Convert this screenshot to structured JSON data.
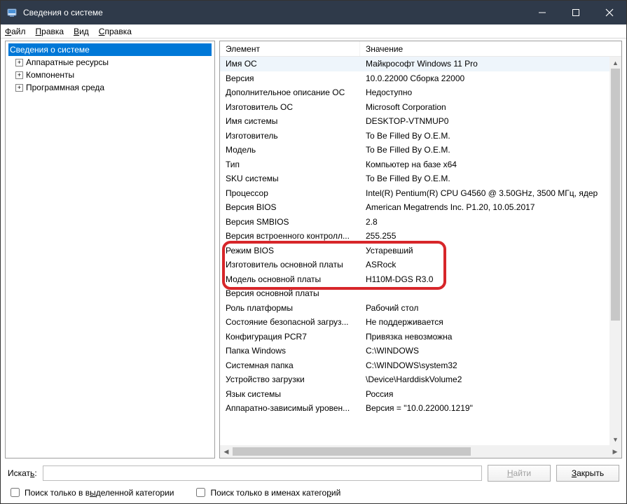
{
  "title": "Сведения о системе",
  "menu": {
    "file": {
      "u": "Ф",
      "rest": "айл"
    },
    "edit": {
      "u": "П",
      "rest": "равка"
    },
    "view": {
      "u": "В",
      "rest": "ид"
    },
    "help": {
      "u": "С",
      "rest": "правка"
    }
  },
  "tree": {
    "root": "Сведения о системе",
    "items": [
      "Аппаратные ресурсы",
      "Компоненты",
      "Программная среда"
    ]
  },
  "columns": {
    "c1": "Элемент",
    "c2": "Значение"
  },
  "data_rows": [
    {
      "el": "Имя ОС",
      "val": "Майкрософт Windows 11 Pro",
      "sel": true
    },
    {
      "el": "Версия",
      "val": "10.0.22000 Сборка 22000"
    },
    {
      "el": "Дополнительное описание ОС",
      "val": "Недоступно"
    },
    {
      "el": "Изготовитель ОС",
      "val": "Microsoft Corporation"
    },
    {
      "el": "Имя системы",
      "val": "DESKTOP-VTNMUP0"
    },
    {
      "el": "Изготовитель",
      "val": "To Be Filled By O.E.M."
    },
    {
      "el": "Модель",
      "val": "To Be Filled By O.E.M."
    },
    {
      "el": "Тип",
      "val": "Компьютер на базе x64"
    },
    {
      "el": "SKU системы",
      "val": "To Be Filled By O.E.M."
    },
    {
      "el": "Процессор",
      "val": "Intel(R) Pentium(R) CPU G4560 @ 3.50GHz, 3500 МГц, ядер"
    },
    {
      "el": "Версия BIOS",
      "val": "American Megatrends Inc. P1.20, 10.05.2017"
    },
    {
      "el": "Версия SMBIOS",
      "val": "2.8"
    },
    {
      "el": "Версия встроенного контролл...",
      "val": "255.255"
    },
    {
      "el": "Режим BIOS",
      "val": "Устаревший"
    },
    {
      "el": "Изготовитель основной платы",
      "val": "ASRock"
    },
    {
      "el": "Модель основной платы",
      "val": "H110M-DGS R3.0"
    },
    {
      "el": "Версия основной платы",
      "val": ""
    },
    {
      "el": "Роль платформы",
      "val": "Рабочий стол"
    },
    {
      "el": "Состояние безопасной загруз...",
      "val": "Не поддерживается"
    },
    {
      "el": "Конфигурация PCR7",
      "val": "Привязка невозможна"
    },
    {
      "el": "Папка Windows",
      "val": "C:\\WINDOWS"
    },
    {
      "el": "Системная папка",
      "val": "C:\\WINDOWS\\system32"
    },
    {
      "el": "Устройство загрузки",
      "val": "\\Device\\HarddiskVolume2"
    },
    {
      "el": "Язык системы",
      "val": "Россия"
    },
    {
      "el": "Аппаратно-зависимый уровен...",
      "val": "Версия = \"10.0.22000.1219\""
    }
  ],
  "search": {
    "label_pre": "Искат",
    "label_u": "ь",
    "label_post": ":",
    "find_u": "Н",
    "find_rest": "айти",
    "close_u": "З",
    "close_rest": "акрыть"
  },
  "check1": {
    "pre": "Поиск только в в",
    "u": "ы",
    "post": "деленной категории"
  },
  "check2": {
    "pre": "Поиск только в именах катего",
    "u": "р",
    "post": "ий"
  }
}
